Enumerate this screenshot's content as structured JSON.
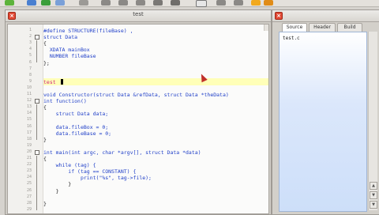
{
  "editor": {
    "title": "test",
    "lines": [
      {
        "n": "1",
        "text": "#define STRUCTURE(fileBase) ,",
        "color": "#1f3fc8"
      },
      {
        "n": "2",
        "text": "struct Data",
        "color": "#1f3fc8"
      },
      {
        "n": "3",
        "text": "{",
        "color": "#222222"
      },
      {
        "n": "4",
        "text": "  XDATA mainBox",
        "color": "#1f3fc8"
      },
      {
        "n": "5",
        "text": "  NUMBER fileBase",
        "color": "#1f3fc8"
      },
      {
        "n": "6",
        "text": "};",
        "color": "#222222"
      },
      {
        "n": "7",
        "text": "",
        "color": "#222222"
      },
      {
        "n": "8",
        "text": "",
        "color": "#222222"
      },
      {
        "n": "9",
        "text": "test",
        "color": "#d0217a"
      },
      {
        "n": "10",
        "text": "",
        "color": "#222222"
      },
      {
        "n": "11",
        "text": "void Constructor(struct Data &refData, struct Data *theData)",
        "color": "#1f3fc8"
      },
      {
        "n": "12",
        "text": "int function()",
        "color": "#1f3fc8"
      },
      {
        "n": "13",
        "text": "{",
        "color": "#222222"
      },
      {
        "n": "14",
        "text": "    struct Data data;",
        "color": "#1f3fc8"
      },
      {
        "n": "15",
        "text": "",
        "color": "#222222"
      },
      {
        "n": "16",
        "text": "    data.fileBox = 0;",
        "color": "#1f3fc8"
      },
      {
        "n": "17",
        "text": "    data.fileBase = 0;",
        "color": "#1f3fc8"
      },
      {
        "n": "18",
        "text": "}",
        "color": "#222222"
      },
      {
        "n": "19",
        "text": "",
        "color": "#222222"
      },
      {
        "n": "20",
        "text": "int main(int argc, char *argv[], struct Data *data)",
        "color": "#1f3fc8"
      },
      {
        "n": "21",
        "text": "{",
        "color": "#222222"
      },
      {
        "n": "22",
        "text": "    while (tag) {",
        "color": "#1f3fc8"
      },
      {
        "n": "23",
        "text": "        if (tag == CONSTANT) {",
        "color": "#1f3fc8"
      },
      {
        "n": "24",
        "text": "            print(\"%s\", tag->file);",
        "color": "#1f3fc8"
      },
      {
        "n": "25",
        "text": "        }",
        "color": "#222222"
      },
      {
        "n": "26",
        "text": "    }",
        "color": "#222222"
      },
      {
        "n": "27",
        "text": "",
        "color": "#222222"
      },
      {
        "n": "28",
        "text": "}",
        "color": "#222222"
      },
      {
        "n": "29",
        "text": "",
        "color": "#222222"
      }
    ]
  },
  "side": {
    "tabs": [
      {
        "label": "Source"
      },
      {
        "label": "Header"
      },
      {
        "label": "Build"
      }
    ],
    "content_text": "test.c"
  }
}
